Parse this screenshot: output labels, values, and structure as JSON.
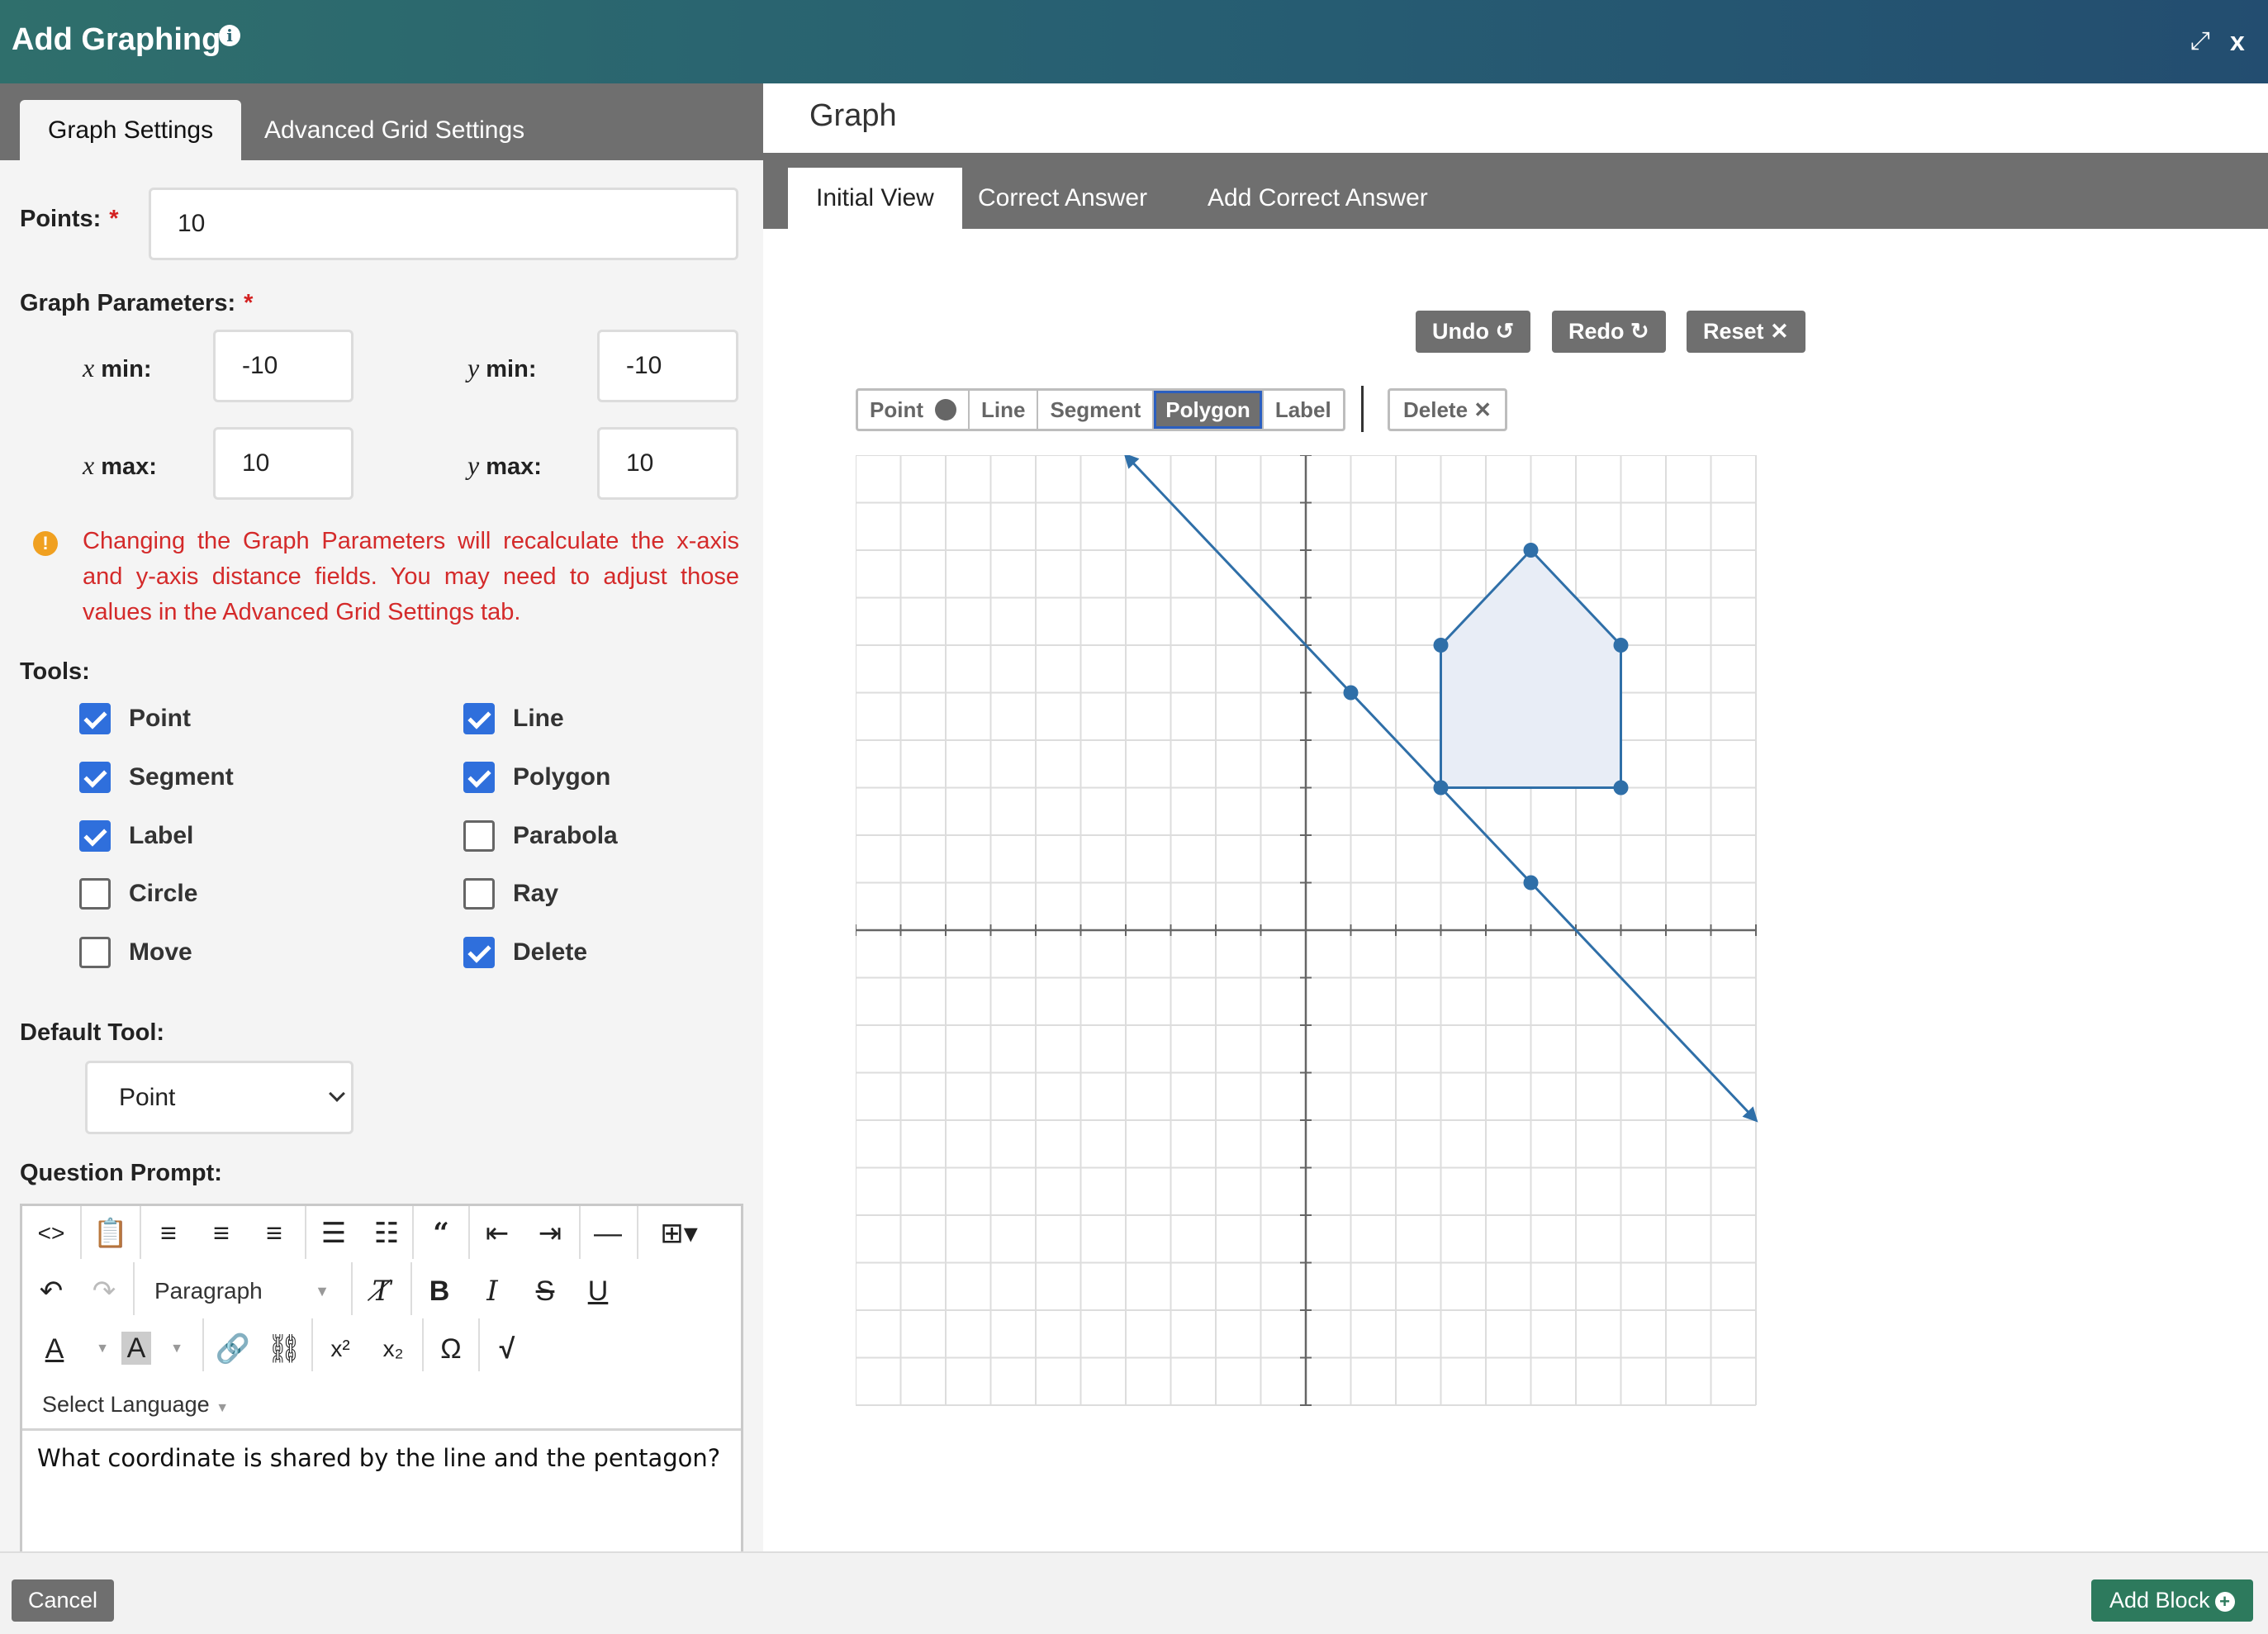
{
  "header": {
    "title": "Add Graphing",
    "expand_icon": "expand-icon",
    "close_label": "x"
  },
  "left": {
    "tabs": [
      {
        "label": "Graph Settings"
      },
      {
        "label": "Advanced Grid Settings"
      }
    ],
    "points_label": "Points:",
    "points_value": "10",
    "params_label": "Graph Parameters:",
    "required_mark": "*",
    "xmin_label": "min:",
    "xmin_value": "-10",
    "ymin_label": "min:",
    "ymin_value": "-10",
    "xmax_label": "max:",
    "xmax_value": "10",
    "ymax_label": "max:",
    "ymax_value": "10",
    "x_var": "x",
    "y_var": "y",
    "warning": "Changing the Graph Parameters will recalculate the x-axis and y-axis distance fields. You may need to adjust those values in the Advanced Grid Settings tab.",
    "tools_label": "Tools:",
    "tools": [
      {
        "label": "Point",
        "checked": true
      },
      {
        "label": "Line",
        "checked": true
      },
      {
        "label": "Segment",
        "checked": true
      },
      {
        "label": "Polygon",
        "checked": true
      },
      {
        "label": "Label",
        "checked": true
      },
      {
        "label": "Parabola",
        "checked": false
      },
      {
        "label": "Circle",
        "checked": false
      },
      {
        "label": "Ray",
        "checked": false
      },
      {
        "label": "Move",
        "checked": false
      },
      {
        "label": "Delete",
        "checked": true
      }
    ],
    "default_tool_label": "Default Tool:",
    "default_tool_value": "Point",
    "prompt_label": "Question Prompt:",
    "editor": {
      "format_value": "Paragraph",
      "language_label": "Select Language",
      "content": "What coordinate is shared by the line and the pentagon?"
    }
  },
  "right": {
    "title": "Graph",
    "tabs": [
      {
        "label": "Initial View"
      },
      {
        "label": "Correct Answer"
      },
      {
        "label": "Add Correct Answer"
      }
    ],
    "actions": {
      "undo": "Undo",
      "redo": "Redo",
      "reset": "Reset"
    },
    "graph_tools": [
      {
        "label": "Point"
      },
      {
        "label": "Line"
      },
      {
        "label": "Segment"
      },
      {
        "label": "Polygon"
      },
      {
        "label": "Label"
      }
    ],
    "active_tool": "Polygon",
    "delete_label": "Delete"
  },
  "chart_data": {
    "type": "scatter",
    "xlim": [
      -10,
      10
    ],
    "ylim": [
      -10,
      10
    ],
    "grid": true,
    "line": {
      "points": [
        [
          1,
          5
        ],
        [
          5,
          1
        ]
      ],
      "extends": "both"
    },
    "polygon": [
      [
        3,
        3
      ],
      [
        3,
        6
      ],
      [
        5,
        8
      ],
      [
        7,
        6
      ],
      [
        7,
        3
      ]
    ],
    "colors": {
      "line": "#2f6fa8",
      "fill": "#e8edf6",
      "grid": "#dddddd",
      "axis": "#666666"
    }
  },
  "footer": {
    "cancel": "Cancel",
    "add_block": "Add Block"
  }
}
